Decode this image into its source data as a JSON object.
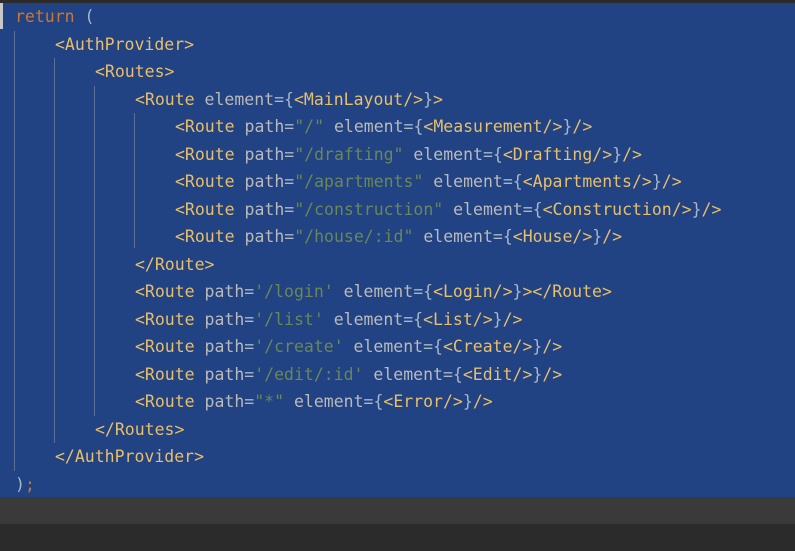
{
  "editor": {
    "lines": [
      {
        "indent": 0,
        "tokens": [
          {
            "t": "return",
            "c": "kw"
          },
          {
            "t": " (",
            "c": "punct"
          }
        ]
      },
      {
        "indent": 1,
        "tokens": [
          {
            "t": "<AuthProvider>",
            "c": "tag"
          }
        ]
      },
      {
        "indent": 2,
        "tokens": [
          {
            "t": "<Routes>",
            "c": "tag"
          }
        ]
      },
      {
        "indent": 3,
        "tokens": [
          {
            "t": "<Route",
            "c": "tag"
          },
          {
            "t": " element",
            "c": "attr"
          },
          {
            "t": "={",
            "c": "punct"
          },
          {
            "t": "<MainLayout/>",
            "c": "tag"
          },
          {
            "t": "}",
            "c": "punct"
          },
          {
            "t": ">",
            "c": "tag"
          }
        ]
      },
      {
        "indent": 4,
        "tokens": [
          {
            "t": "<Route",
            "c": "tag"
          },
          {
            "t": " path",
            "c": "attr"
          },
          {
            "t": "=",
            "c": "punct"
          },
          {
            "t": "\"/\"",
            "c": "str"
          },
          {
            "t": " element",
            "c": "attr"
          },
          {
            "t": "={",
            "c": "punct"
          },
          {
            "t": "<Measurement/>",
            "c": "tag"
          },
          {
            "t": "}",
            "c": "punct"
          },
          {
            "t": "/>",
            "c": "tag"
          }
        ]
      },
      {
        "indent": 4,
        "tokens": [
          {
            "t": "<Route",
            "c": "tag"
          },
          {
            "t": " path",
            "c": "attr"
          },
          {
            "t": "=",
            "c": "punct"
          },
          {
            "t": "\"/drafting\"",
            "c": "str"
          },
          {
            "t": " element",
            "c": "attr"
          },
          {
            "t": "={",
            "c": "punct"
          },
          {
            "t": "<Drafting/>",
            "c": "tag"
          },
          {
            "t": "}",
            "c": "punct"
          },
          {
            "t": "/>",
            "c": "tag"
          }
        ]
      },
      {
        "indent": 4,
        "tokens": [
          {
            "t": "<Route",
            "c": "tag"
          },
          {
            "t": " path",
            "c": "attr"
          },
          {
            "t": "=",
            "c": "punct"
          },
          {
            "t": "\"/apartments\"",
            "c": "str"
          },
          {
            "t": " element",
            "c": "attr"
          },
          {
            "t": "={",
            "c": "punct"
          },
          {
            "t": "<Apartments/>",
            "c": "tag"
          },
          {
            "t": "}",
            "c": "punct"
          },
          {
            "t": "/>",
            "c": "tag"
          }
        ]
      },
      {
        "indent": 4,
        "tokens": [
          {
            "t": "<Route",
            "c": "tag"
          },
          {
            "t": " path",
            "c": "attr"
          },
          {
            "t": "=",
            "c": "punct"
          },
          {
            "t": "\"/construction\"",
            "c": "str"
          },
          {
            "t": " element",
            "c": "attr"
          },
          {
            "t": "={",
            "c": "punct"
          },
          {
            "t": "<Construction/>",
            "c": "tag"
          },
          {
            "t": "}",
            "c": "punct"
          },
          {
            "t": "/>",
            "c": "tag"
          }
        ]
      },
      {
        "indent": 4,
        "tokens": [
          {
            "t": "<Route",
            "c": "tag"
          },
          {
            "t": " path",
            "c": "attr"
          },
          {
            "t": "=",
            "c": "punct"
          },
          {
            "t": "\"/house/:id\"",
            "c": "str"
          },
          {
            "t": " element",
            "c": "attr"
          },
          {
            "t": "={",
            "c": "punct"
          },
          {
            "t": "<House/>",
            "c": "tag"
          },
          {
            "t": "}",
            "c": "punct"
          },
          {
            "t": "/>",
            "c": "tag"
          }
        ]
      },
      {
        "indent": 3,
        "tokens": [
          {
            "t": "</Route>",
            "c": "tag"
          }
        ]
      },
      {
        "indent": 3,
        "tokens": [
          {
            "t": "<Route",
            "c": "tag"
          },
          {
            "t": " path",
            "c": "attr"
          },
          {
            "t": "=",
            "c": "punct"
          },
          {
            "t": "'/login'",
            "c": "str"
          },
          {
            "t": " element",
            "c": "attr"
          },
          {
            "t": "={",
            "c": "punct"
          },
          {
            "t": "<Login/>",
            "c": "tag"
          },
          {
            "t": "}",
            "c": "punct"
          },
          {
            "t": "></Route>",
            "c": "tag"
          }
        ]
      },
      {
        "indent": 3,
        "tokens": [
          {
            "t": "<Route",
            "c": "tag"
          },
          {
            "t": " path",
            "c": "attr"
          },
          {
            "t": "=",
            "c": "punct"
          },
          {
            "t": "'/list'",
            "c": "str"
          },
          {
            "t": " element",
            "c": "attr"
          },
          {
            "t": "={",
            "c": "punct"
          },
          {
            "t": "<List/>",
            "c": "tag"
          },
          {
            "t": "}",
            "c": "punct"
          },
          {
            "t": "/>",
            "c": "tag"
          }
        ]
      },
      {
        "indent": 3,
        "tokens": [
          {
            "t": "<Route",
            "c": "tag"
          },
          {
            "t": " path",
            "c": "attr"
          },
          {
            "t": "=",
            "c": "punct"
          },
          {
            "t": "'/create'",
            "c": "str"
          },
          {
            "t": " element",
            "c": "attr"
          },
          {
            "t": "={",
            "c": "punct"
          },
          {
            "t": "<Create/>",
            "c": "tag"
          },
          {
            "t": "}",
            "c": "punct"
          },
          {
            "t": "/>",
            "c": "tag"
          }
        ]
      },
      {
        "indent": 3,
        "tokens": [
          {
            "t": "<Route",
            "c": "tag"
          },
          {
            "t": " path",
            "c": "attr"
          },
          {
            "t": "=",
            "c": "punct"
          },
          {
            "t": "'/edit/:id'",
            "c": "str"
          },
          {
            "t": " element",
            "c": "attr"
          },
          {
            "t": "={",
            "c": "punct"
          },
          {
            "t": "<Edit/>",
            "c": "tag"
          },
          {
            "t": "}",
            "c": "punct"
          },
          {
            "t": "/>",
            "c": "tag"
          }
        ]
      },
      {
        "indent": 3,
        "tokens": [
          {
            "t": "<Route",
            "c": "tag"
          },
          {
            "t": " path",
            "c": "attr"
          },
          {
            "t": "=",
            "c": "punct"
          },
          {
            "t": "\"*\"",
            "c": "str"
          },
          {
            "t": " element",
            "c": "attr"
          },
          {
            "t": "={",
            "c": "punct"
          },
          {
            "t": "<Error/>",
            "c": "tag"
          },
          {
            "t": "}",
            "c": "punct"
          },
          {
            "t": "/>",
            "c": "tag"
          }
        ]
      },
      {
        "indent": 2,
        "tokens": [
          {
            "t": "</Routes>",
            "c": "tag"
          }
        ]
      },
      {
        "indent": 1,
        "tokens": [
          {
            "t": "</AuthProvider>",
            "c": "tag"
          }
        ]
      },
      {
        "indent": 0,
        "tokens": [
          {
            "t": ")",
            "c": "punct"
          },
          {
            "t": ";",
            "c": "kw"
          }
        ]
      }
    ]
  },
  "colors": {
    "selection_bg": "#214283",
    "editor_bg": "#2b2b2b",
    "keyword": "#cc7832",
    "tag": "#e8bf6a",
    "attribute": "#bababa",
    "string": "#6a8759",
    "text": "#a9b7c6"
  }
}
